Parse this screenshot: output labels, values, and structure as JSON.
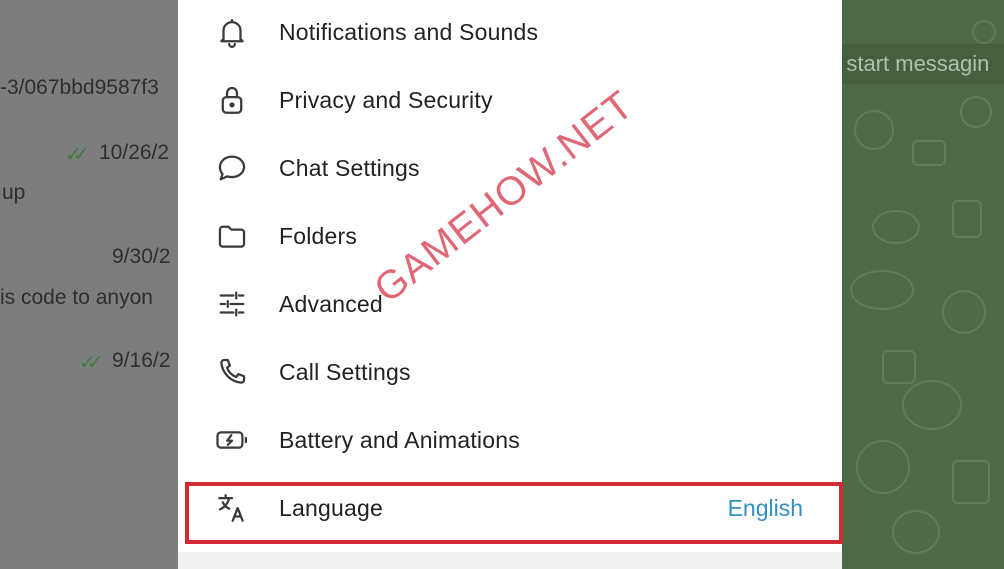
{
  "background_left": {
    "fragments": [
      "-3/067bbd9587f3",
      "10/26/2",
      "up",
      "9/30/2",
      "is code to anyon",
      "9/16/2"
    ]
  },
  "background_right": {
    "start_messaging_text": "o start messagin"
  },
  "settings": {
    "items": [
      {
        "label": "Notifications and Sounds",
        "icon": "bell-icon"
      },
      {
        "label": "Privacy and Security",
        "icon": "lock-icon"
      },
      {
        "label": "Chat Settings",
        "icon": "chat-bubble-icon"
      },
      {
        "label": "Folders",
        "icon": "folder-icon"
      },
      {
        "label": "Advanced",
        "icon": "sliders-icon"
      },
      {
        "label": "Call Settings",
        "icon": "phone-icon"
      },
      {
        "label": "Battery and Animations",
        "icon": "battery-icon"
      },
      {
        "label": "Language",
        "icon": "translate-icon",
        "value": "English"
      }
    ]
  },
  "watermark": "GAMEHOW.NET",
  "colors": {
    "accent": "#3390c4",
    "highlight_border": "#d12a33",
    "read_check": "#3f7f3a"
  }
}
